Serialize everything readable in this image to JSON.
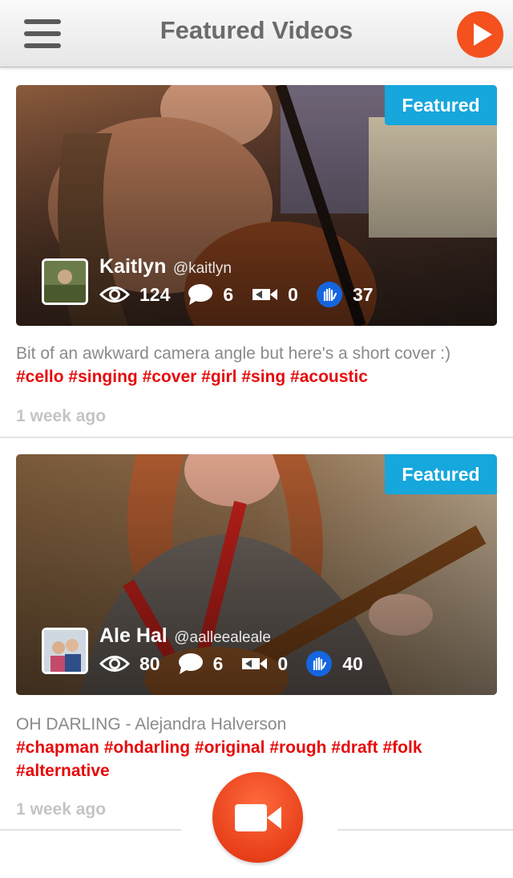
{
  "header": {
    "title": "Featured Videos",
    "menu_icon": "hamburger-menu-icon",
    "play_icon": "play-icon",
    "accent_color": "#f4511e"
  },
  "posts": [
    {
      "badge": "Featured",
      "username": "Kaitlyn",
      "handle": "@kaitlyn",
      "stats": {
        "views": "124",
        "comments": "6",
        "reshares": "0",
        "claps": "37"
      },
      "description": "Bit of an awkward camera angle but here's a short cover :) ",
      "tags": [
        "#cello",
        "#singing",
        "#cover",
        "#girl",
        "#sing",
        "#acoustic"
      ],
      "time": "1 week ago"
    },
    {
      "badge": "Featured",
      "username": "Ale Hal",
      "handle": "@aalleealeale",
      "stats": {
        "views": "80",
        "comments": "6",
        "reshares": "0",
        "claps": "40"
      },
      "description": "OH DARLING - Alejandra Halverson",
      "tags": [
        "#chapman",
        "#ohdarling",
        "#original",
        "#rough",
        "#draft",
        "#folk",
        "#alternative"
      ],
      "time": "1 week ago"
    }
  ],
  "record_button": {
    "icon": "video-camera-icon",
    "color": "#e8401a"
  },
  "colors": {
    "tag": "#e60b0b",
    "badge": "#16a7dc",
    "clap_badge": "#1565e0"
  }
}
